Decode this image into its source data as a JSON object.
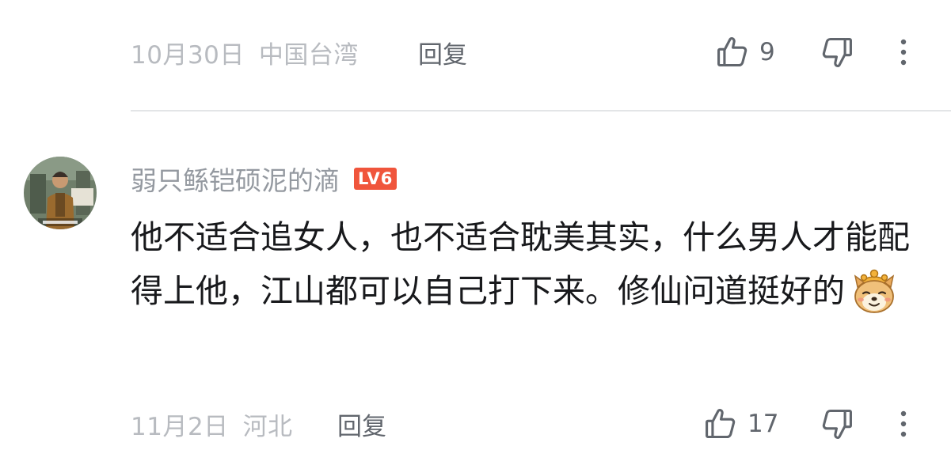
{
  "comment_1": {
    "date": "10月30日",
    "location": "中国台湾",
    "reply_label": "回复",
    "like_count": "9"
  },
  "comment_2": {
    "username": "弱只鲧铠硕泥的滴",
    "level_badge": "LV6",
    "text": "他不适合追女人，也不适合耽美其实，什么男人才能配得上他，江山都可以自己打下来。修仙问道挺好的",
    "emoji": "doge-emoji",
    "date": "11月2日",
    "location": "河北",
    "reply_label": "回复",
    "like_count": "17"
  },
  "colors": {
    "meta_gray": "#b8bbc0",
    "action_gray": "#61666d",
    "username_gray": "#9499a0",
    "level_red": "#f0553c",
    "divider": "#e3e5e7"
  },
  "icons": [
    "thumbs-up-icon",
    "thumbs-down-icon",
    "more-vertical-icon"
  ]
}
